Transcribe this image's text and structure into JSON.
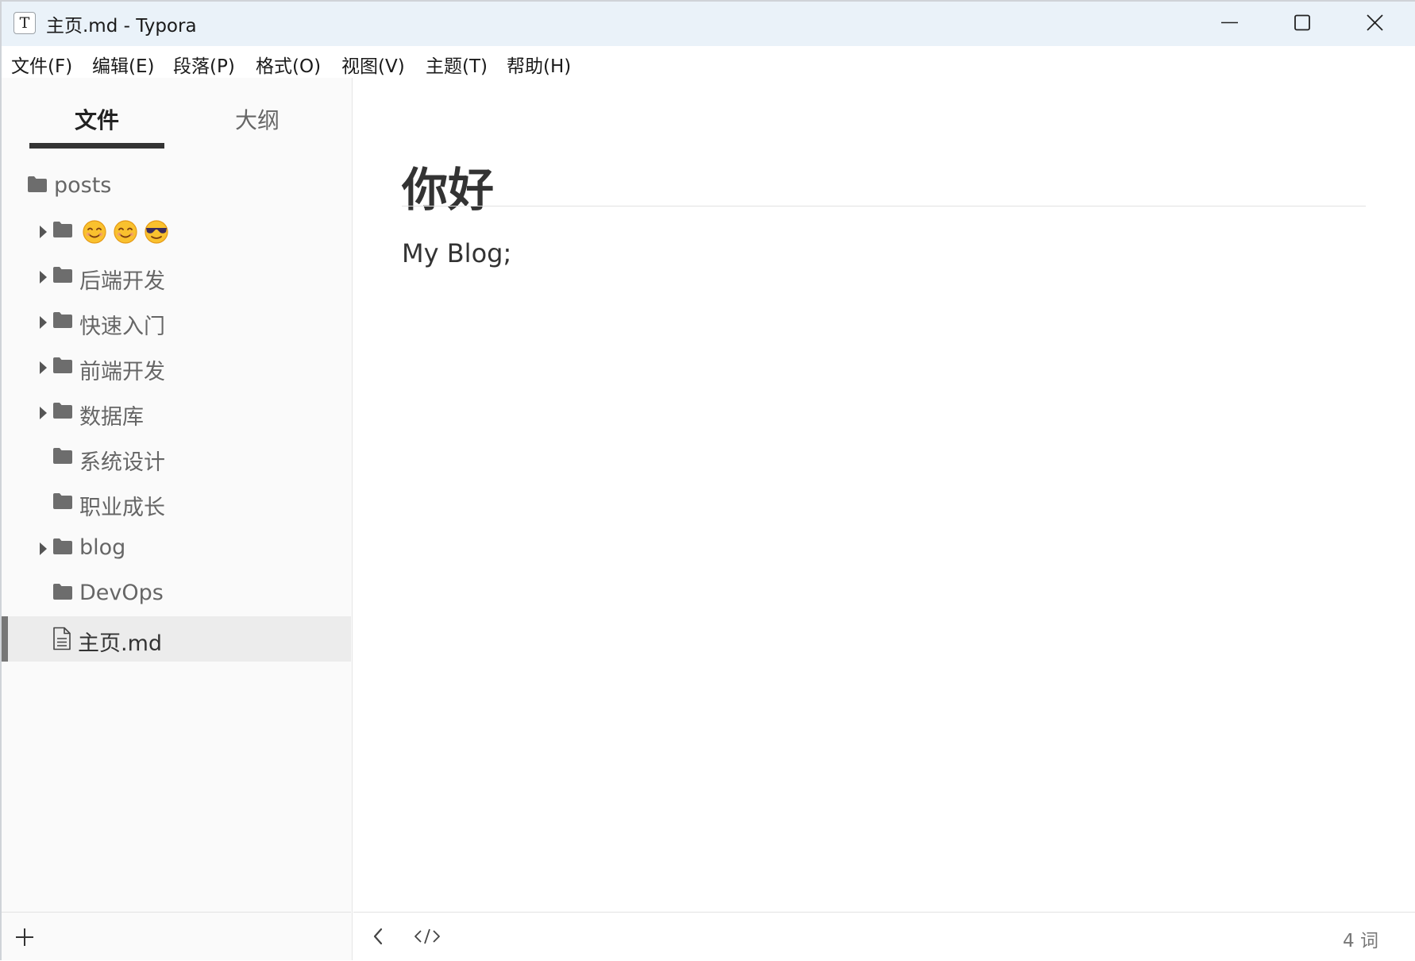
{
  "titlebar": {
    "app_icon_letter": "T",
    "title": "主页.md - Typora",
    "minimize_icon": "minimize-icon",
    "maximize_icon": "maximize-icon",
    "close_icon": "close-icon"
  },
  "menu": {
    "items": [
      "文件(F)",
      "编辑(E)",
      "段落(P)",
      "格式(O)",
      "视图(V)",
      "主题(T)",
      "帮助(H)"
    ]
  },
  "sidebar": {
    "tabs": {
      "files": "文件",
      "outline": "大纲",
      "active": "files"
    },
    "root": "posts",
    "tree": [
      {
        "label": "😊😊😎",
        "type": "folder",
        "expandable": true
      },
      {
        "label": "后端开发",
        "type": "folder",
        "expandable": true
      },
      {
        "label": "快速入门",
        "type": "folder",
        "expandable": true
      },
      {
        "label": "前端开发",
        "type": "folder",
        "expandable": true
      },
      {
        "label": "数据库",
        "type": "folder",
        "expandable": true
      },
      {
        "label": "系统设计",
        "type": "folder",
        "expandable": false
      },
      {
        "label": "职业成长",
        "type": "folder",
        "expandable": false
      },
      {
        "label": "blog",
        "type": "folder",
        "expandable": true
      },
      {
        "label": "DevOps",
        "type": "folder",
        "expandable": false
      },
      {
        "label": "主页.md",
        "type": "file",
        "expandable": false,
        "active": true
      }
    ]
  },
  "editor": {
    "heading": "你好",
    "paragraph": "My Blog;"
  },
  "statusbar": {
    "word_count": "4 词"
  },
  "colors": {
    "titlebar_bg": "#eaf2f9",
    "sidebar_bg": "#fafafa",
    "active_row_bg": "#ececec",
    "text": "#333333",
    "muted_text": "#666666"
  }
}
